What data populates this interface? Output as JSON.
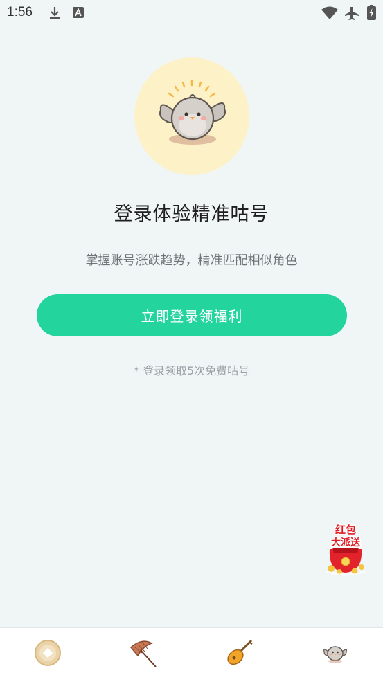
{
  "status_bar": {
    "time": "1:56",
    "icons": [
      "download-icon",
      "keyboard-a-icon",
      "wifi-icon",
      "airplane-icon",
      "battery-charging-icon"
    ]
  },
  "hero": {
    "image": "bird-mascot-illustration"
  },
  "main": {
    "title": "登录体验精准咕号",
    "subtitle": "掌握账号涨跌趋势，精准匹配相似角色",
    "login_button_label": "立即登录领福利",
    "footnote": "* 登录领取5次免费咕号"
  },
  "red_packet": {
    "line1": "红包",
    "line2": "大派送"
  },
  "bottom_nav": {
    "items": [
      {
        "icon": "coin-icon"
      },
      {
        "icon": "umbrella-icon"
      },
      {
        "icon": "pipa-icon"
      },
      {
        "icon": "bird-avatar-icon"
      }
    ]
  },
  "colors": {
    "accent": "#23d59c",
    "background": "#f0f5f5",
    "hero_circle": "#fdf1c8"
  }
}
